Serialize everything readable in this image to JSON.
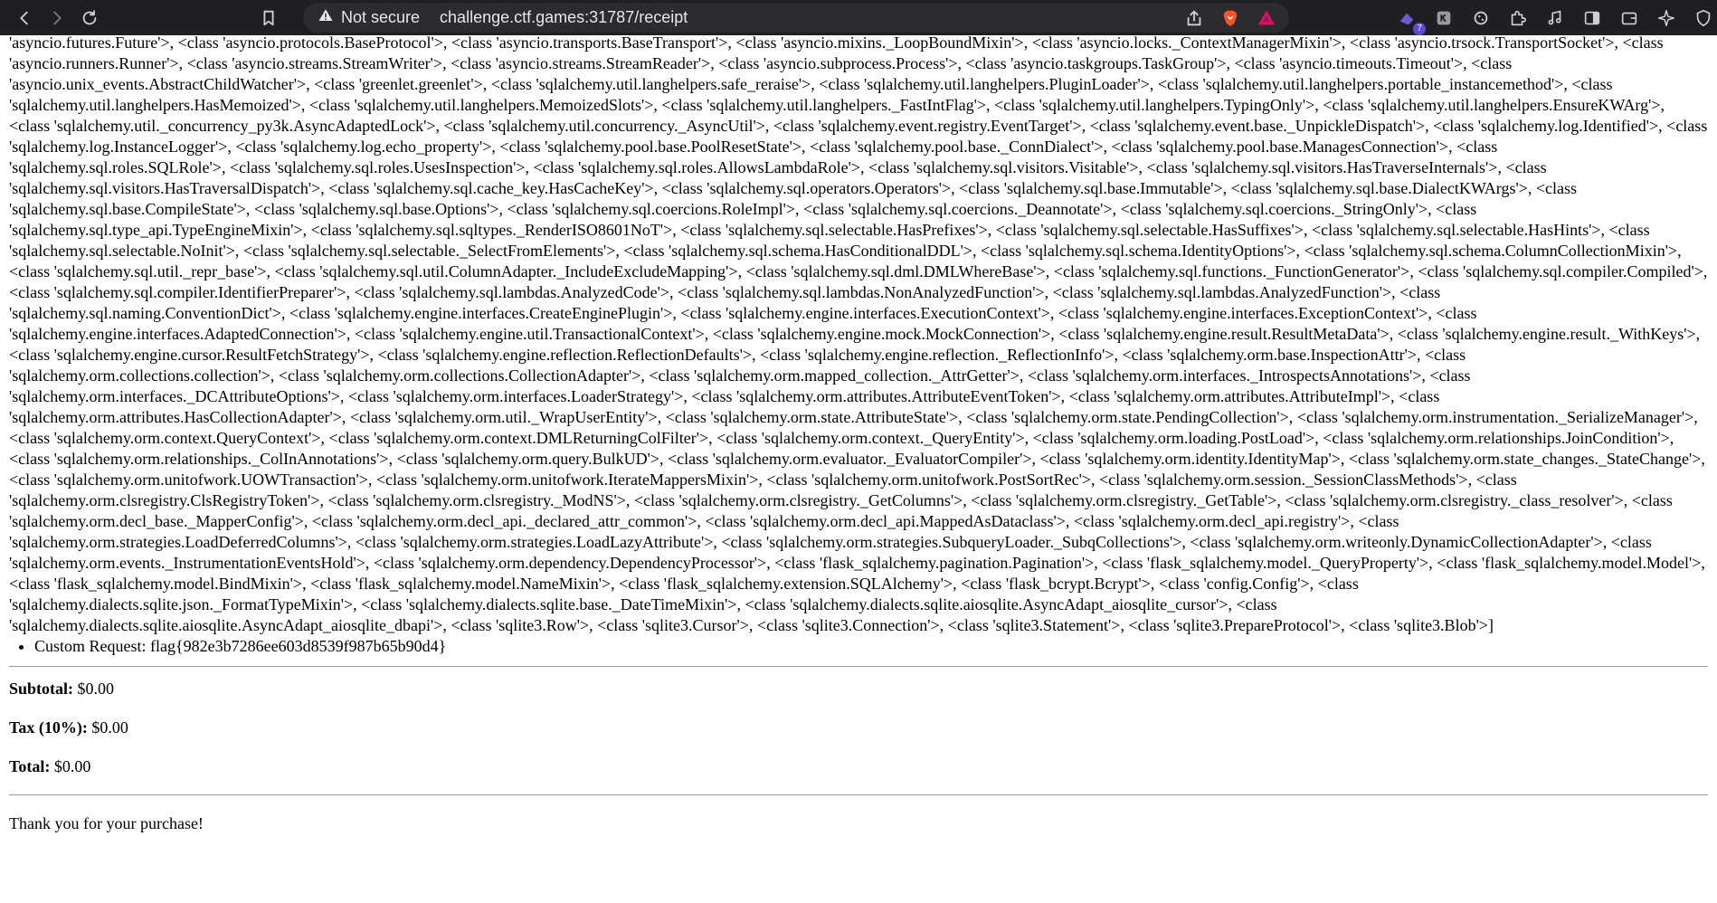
{
  "browser": {
    "security_label": "Not secure",
    "url": "challenge.ctf.games:31787/receipt",
    "extension_badge": "7"
  },
  "receipt": {
    "class_dump": "'asyncio.futures.Future'>, <class 'asyncio.protocols.BaseProtocol'>, <class 'asyncio.transports.BaseTransport'>, <class 'asyncio.mixins._LoopBoundMixin'>, <class 'asyncio.locks._ContextManagerMixin'>, <class 'asyncio.trsock.TransportSocket'>, <class 'asyncio.runners.Runner'>, <class 'asyncio.streams.StreamWriter'>, <class 'asyncio.streams.StreamReader'>, <class 'asyncio.subprocess.Process'>, <class 'asyncio.taskgroups.TaskGroup'>, <class 'asyncio.timeouts.Timeout'>, <class 'asyncio.unix_events.AbstractChildWatcher'>, <class 'greenlet.greenlet'>, <class 'sqlalchemy.util.langhelpers.safe_reraise'>, <class 'sqlalchemy.util.langhelpers.PluginLoader'>, <class 'sqlalchemy.util.langhelpers.portable_instancemethod'>, <class 'sqlalchemy.util.langhelpers.HasMemoized'>, <class 'sqlalchemy.util.langhelpers.MemoizedSlots'>, <class 'sqlalchemy.util.langhelpers._FastIntFlag'>, <class 'sqlalchemy.util.langhelpers.TypingOnly'>, <class 'sqlalchemy.util.langhelpers.EnsureKWArg'>, <class 'sqlalchemy.util._concurrency_py3k.AsyncAdaptedLock'>, <class 'sqlalchemy.util.concurrency._AsyncUtil'>, <class 'sqlalchemy.event.registry.EventTarget'>, <class 'sqlalchemy.event.base._UnpickleDispatch'>, <class 'sqlalchemy.log.Identified'>, <class 'sqlalchemy.log.InstanceLogger'>, <class 'sqlalchemy.log.echo_property'>, <class 'sqlalchemy.pool.base.PoolResetState'>, <class 'sqlalchemy.pool.base._ConnDialect'>, <class 'sqlalchemy.pool.base.ManagesConnection'>, <class 'sqlalchemy.sql.roles.SQLRole'>, <class 'sqlalchemy.sql.roles.UsesInspection'>, <class 'sqlalchemy.sql.roles.AllowsLambdaRole'>, <class 'sqlalchemy.sql.visitors.Visitable'>, <class 'sqlalchemy.sql.visitors.HasTraverseInternals'>, <class 'sqlalchemy.sql.visitors.HasTraversalDispatch'>, <class 'sqlalchemy.sql.cache_key.HasCacheKey'>, <class 'sqlalchemy.sql.operators.Operators'>, <class 'sqlalchemy.sql.base.Immutable'>, <class 'sqlalchemy.sql.base.DialectKWArgs'>, <class 'sqlalchemy.sql.base.CompileState'>, <class 'sqlalchemy.sql.base.Options'>, <class 'sqlalchemy.sql.coercions.RoleImpl'>, <class 'sqlalchemy.sql.coercions._Deannotate'>, <class 'sqlalchemy.sql.coercions._StringOnly'>, <class 'sqlalchemy.sql.type_api.TypeEngineMixin'>, <class 'sqlalchemy.sql.sqltypes._RenderISO8601NoT'>, <class 'sqlalchemy.sql.selectable.HasPrefixes'>, <class 'sqlalchemy.sql.selectable.HasSuffixes'>, <class 'sqlalchemy.sql.selectable.HasHints'>, <class 'sqlalchemy.sql.selectable.NoInit'>, <class 'sqlalchemy.sql.selectable._SelectFromElements'>, <class 'sqlalchemy.sql.schema.HasConditionalDDL'>, <class 'sqlalchemy.sql.schema.IdentityOptions'>, <class 'sqlalchemy.sql.schema.ColumnCollectionMixin'>, <class 'sqlalchemy.sql.util._repr_base'>, <class 'sqlalchemy.sql.util.ColumnAdapter._IncludeExcludeMapping'>, <class 'sqlalchemy.sql.dml.DMLWhereBase'>, <class 'sqlalchemy.sql.functions._FunctionGenerator'>, <class 'sqlalchemy.sql.compiler.Compiled'>, <class 'sqlalchemy.sql.compiler.IdentifierPreparer'>, <class 'sqlalchemy.sql.lambdas.AnalyzedCode'>, <class 'sqlalchemy.sql.lambdas.NonAnalyzedFunction'>, <class 'sqlalchemy.sql.lambdas.AnalyzedFunction'>, <class 'sqlalchemy.sql.naming.ConventionDict'>, <class 'sqlalchemy.engine.interfaces.CreateEnginePlugin'>, <class 'sqlalchemy.engine.interfaces.ExecutionContext'>, <class 'sqlalchemy.engine.interfaces.ExceptionContext'>, <class 'sqlalchemy.engine.interfaces.AdaptedConnection'>, <class 'sqlalchemy.engine.util.TransactionalContext'>, <class 'sqlalchemy.engine.mock.MockConnection'>, <class 'sqlalchemy.engine.result.ResultMetaData'>, <class 'sqlalchemy.engine.result._WithKeys'>, <class 'sqlalchemy.engine.cursor.ResultFetchStrategy'>, <class 'sqlalchemy.engine.reflection.ReflectionDefaults'>, <class 'sqlalchemy.engine.reflection._ReflectionInfo'>, <class 'sqlalchemy.orm.base.InspectionAttr'>, <class 'sqlalchemy.orm.collections.collection'>, <class 'sqlalchemy.orm.collections.CollectionAdapter'>, <class 'sqlalchemy.orm.mapped_collection._AttrGetter'>, <class 'sqlalchemy.orm.interfaces._IntrospectsAnnotations'>, <class 'sqlalchemy.orm.interfaces._DCAttributeOptions'>, <class 'sqlalchemy.orm.interfaces.LoaderStrategy'>, <class 'sqlalchemy.orm.attributes.AttributeEventToken'>, <class 'sqlalchemy.orm.attributes.AttributeImpl'>, <class 'sqlalchemy.orm.attributes.HasCollectionAdapter'>, <class 'sqlalchemy.orm.util._WrapUserEntity'>, <class 'sqlalchemy.orm.state.AttributeState'>, <class 'sqlalchemy.orm.state.PendingCollection'>, <class 'sqlalchemy.orm.instrumentation._SerializeManager'>, <class 'sqlalchemy.orm.context.QueryContext'>, <class 'sqlalchemy.orm.context.DMLReturningColFilter'>, <class 'sqlalchemy.orm.context._QueryEntity'>, <class 'sqlalchemy.orm.loading.PostLoad'>, <class 'sqlalchemy.orm.relationships.JoinCondition'>, <class 'sqlalchemy.orm.relationships._ColInAnnotations'>, <class 'sqlalchemy.orm.query.BulkUD'>, <class 'sqlalchemy.orm.evaluator._EvaluatorCompiler'>, <class 'sqlalchemy.orm.identity.IdentityMap'>, <class 'sqlalchemy.orm.state_changes._StateChange'>, <class 'sqlalchemy.orm.unitofwork.UOWTransaction'>, <class 'sqlalchemy.orm.unitofwork.IterateMappersMixin'>, <class 'sqlalchemy.orm.unitofwork.PostSortRec'>, <class 'sqlalchemy.orm.session._SessionClassMethods'>, <class 'sqlalchemy.orm.clsregistry.ClsRegistryToken'>, <class 'sqlalchemy.orm.clsregistry._ModNS'>, <class 'sqlalchemy.orm.clsregistry._GetColumns'>, <class 'sqlalchemy.orm.clsregistry._GetTable'>, <class 'sqlalchemy.orm.clsregistry._class_resolver'>, <class 'sqlalchemy.orm.decl_base._MapperConfig'>, <class 'sqlalchemy.orm.decl_api._declared_attr_common'>, <class 'sqlalchemy.orm.decl_api.MappedAsDataclass'>, <class 'sqlalchemy.orm.decl_api.registry'>, <class 'sqlalchemy.orm.strategies.LoadDeferredColumns'>, <class 'sqlalchemy.orm.strategies.LoadLazyAttribute'>, <class 'sqlalchemy.orm.strategies.SubqueryLoader._SubqCollections'>, <class 'sqlalchemy.orm.writeonly.DynamicCollectionAdapter'>, <class 'sqlalchemy.orm.events._InstrumentationEventsHold'>, <class 'sqlalchemy.orm.dependency.DependencyProcessor'>, <class 'flask_sqlalchemy.pagination.Pagination'>, <class 'flask_sqlalchemy.model._QueryProperty'>, <class 'flask_sqlalchemy.model.Model'>, <class 'flask_sqlalchemy.model.BindMixin'>, <class 'flask_sqlalchemy.model.NameMixin'>, <class 'flask_sqlalchemy.extension.SQLAlchemy'>, <class 'flask_bcrypt.Bcrypt'>, <class 'config.Config'>, <class 'sqlalchemy.dialects.sqlite.json._FormatTypeMixin'>, <class 'sqlalchemy.dialects.sqlite.base._DateTimeMixin'>, <class 'sqlalchemy.dialects.sqlite.aiosqlite.AsyncAdapt_aiosqlite_cursor'>, <class 'sqlalchemy.dialects.sqlite.aiosqlite.AsyncAdapt_aiosqlite_dbapi'>, <class 'sqlite3.Row'>, <class 'sqlite3.Cursor'>, <class 'sqlite3.Connection'>, <class 'sqlite3.Statement'>, <class 'sqlite3.PrepareProtocol'>, <class 'sqlite3.Blob'>]",
    "custom_request": "Custom Request: flag{982e3b7286ee603d8539f987b65b90d4}",
    "subtotal_label": "Subtotal:",
    "subtotal_value": " $0.00",
    "tax_label": "Tax (10%):",
    "tax_value": " $0.00",
    "total_label": "Total:",
    "total_value": " $0.00",
    "thanks": "Thank you for your purchase!"
  }
}
